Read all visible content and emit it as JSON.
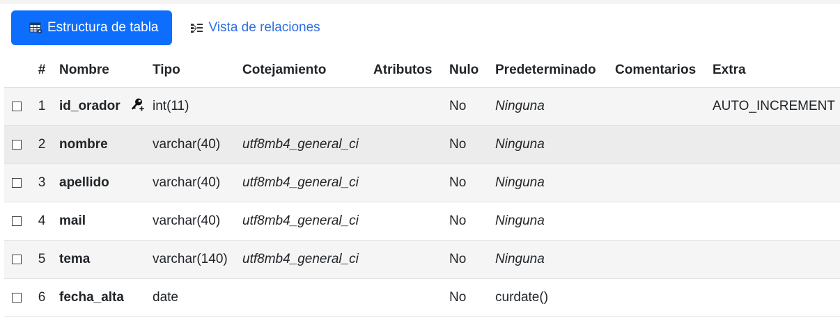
{
  "tabs": [
    {
      "label": "Estructura de tabla",
      "icon": "table-structure-icon",
      "active": true
    },
    {
      "label": "Vista de relaciones",
      "icon": "relations-icon",
      "active": false
    }
  ],
  "columns": [
    "#",
    "Nombre",
    "Tipo",
    "Cotejamiento",
    "Atributos",
    "Nulo",
    "Predeterminado",
    "Comentarios",
    "Extra"
  ],
  "rows": [
    {
      "num": "1",
      "name": "id_orador",
      "type": "int(11)",
      "collation": "",
      "attributes": "",
      "null": "No",
      "default": "Ninguna",
      "comments": "",
      "extra": "AUTO_INCREMENT",
      "key_icon": "primary-key-icon"
    },
    {
      "num": "2",
      "name": "nombre",
      "type": "varchar(40)",
      "collation": "utf8mb4_general_ci",
      "attributes": "",
      "null": "No",
      "default": "Ninguna",
      "comments": "",
      "extra": ""
    },
    {
      "num": "3",
      "name": "apellido",
      "type": "varchar(40)",
      "collation": "utf8mb4_general_ci",
      "attributes": "",
      "null": "No",
      "default": "Ninguna",
      "comments": "",
      "extra": ""
    },
    {
      "num": "4",
      "name": "mail",
      "type": "varchar(40)",
      "collation": "utf8mb4_general_ci",
      "attributes": "",
      "null": "No",
      "default": "Ninguna",
      "comments": "",
      "extra": ""
    },
    {
      "num": "5",
      "name": "tema",
      "type": "varchar(140)",
      "collation": "utf8mb4_general_ci",
      "attributes": "",
      "null": "No",
      "default": "Ninguna",
      "comments": "",
      "extra": ""
    },
    {
      "num": "6",
      "name": "fecha_alta",
      "type": "date",
      "collation": "",
      "attributes": "",
      "null": "No",
      "default": "curdate()",
      "comments": "",
      "extra": ""
    }
  ],
  "colors": {
    "accent": "#0d6efd",
    "link": "#2f6fe0",
    "row_shade": "#ececec",
    "row_light": "#f5f5f5"
  }
}
